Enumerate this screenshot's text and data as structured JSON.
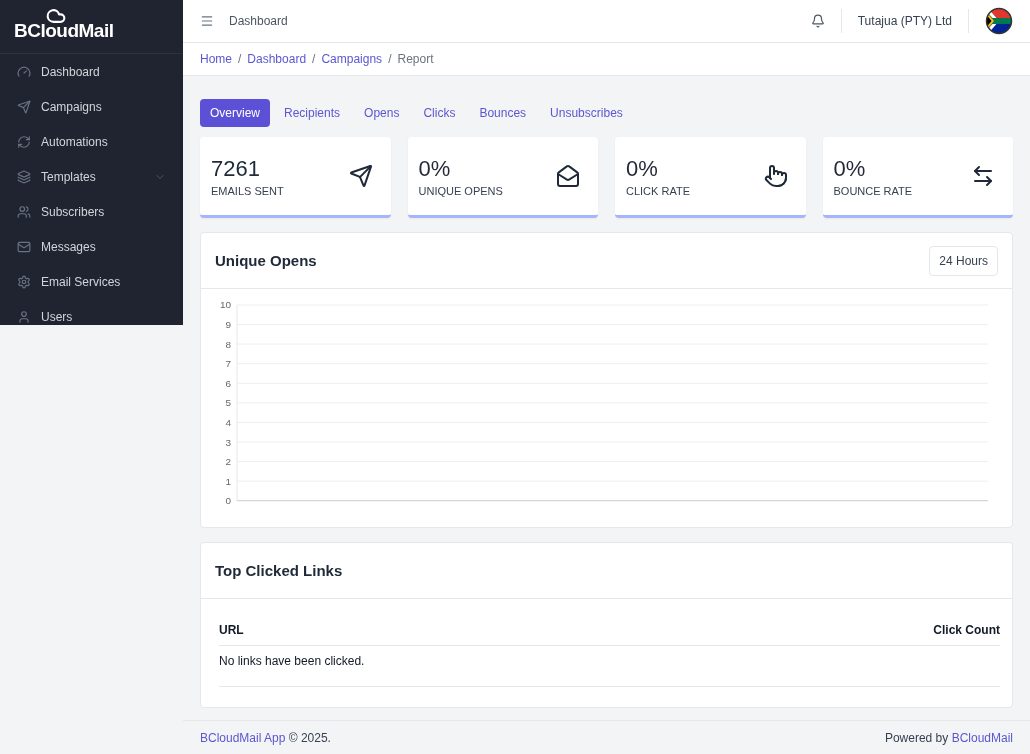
{
  "sidebar": {
    "logo": "BCloudMail",
    "items": [
      {
        "label": "Dashboard",
        "expandable": false
      },
      {
        "label": "Campaigns",
        "expandable": false
      },
      {
        "label": "Automations",
        "expandable": false
      },
      {
        "label": "Templates",
        "expandable": true
      },
      {
        "label": "Subscribers",
        "expandable": false
      },
      {
        "label": "Messages",
        "expandable": false
      },
      {
        "label": "Email Services",
        "expandable": false
      },
      {
        "label": "Users",
        "expandable": false
      }
    ]
  },
  "topbar": {
    "title": "Dashboard",
    "account": "Tutajua (PTY) Ltd"
  },
  "breadcrumb": [
    {
      "kind": "link",
      "label": "Home"
    },
    {
      "kind": "separator",
      "label": "/"
    },
    {
      "kind": "link",
      "label": "Dashboard"
    },
    {
      "kind": "separator",
      "label": "/"
    },
    {
      "kind": "link",
      "label": "Campaigns"
    },
    {
      "kind": "separator",
      "label": "/"
    },
    {
      "kind": "current",
      "label": "Report"
    }
  ],
  "tabs": [
    {
      "label": "Overview",
      "selected": true
    },
    {
      "label": "Recipients",
      "selected": false
    },
    {
      "label": "Opens",
      "selected": false
    },
    {
      "label": "Clicks",
      "selected": false
    },
    {
      "label": "Bounces",
      "selected": false
    },
    {
      "label": "Unsubscribes",
      "selected": false
    }
  ],
  "stats": [
    {
      "value": "7261",
      "label": "EMAILS SENT"
    },
    {
      "value": "0%",
      "label": "UNIQUE OPENS"
    },
    {
      "value": "0%",
      "label": "CLICK RATE"
    },
    {
      "value": "0%",
      "label": "BOUNCE RATE"
    }
  ],
  "opens_card": {
    "title": "Unique Opens",
    "range_button": "24 Hours",
    "y_axis_labels": [
      "10",
      "9",
      "8",
      "7",
      "6",
      "5",
      "4",
      "3",
      "2",
      "1",
      "0"
    ]
  },
  "links_card": {
    "title": "Top Clicked Links",
    "columns": [
      "URL",
      "Click Count"
    ],
    "empty_message": "No links have been clicked."
  },
  "footer": {
    "brand": "BCloudMail App",
    "copyright": "© 2025.",
    "powered_by": "Powered by",
    "powered_link": "BCloudMail"
  }
}
